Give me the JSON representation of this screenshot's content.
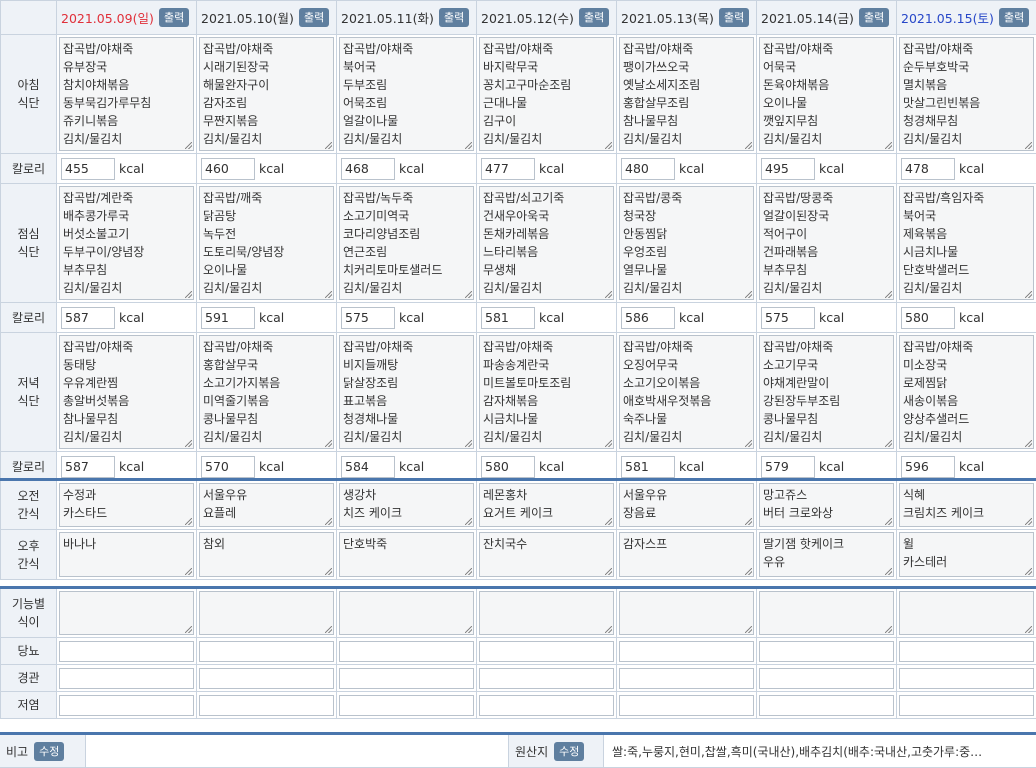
{
  "print_label": "출력",
  "kcal_unit": "kcal",
  "days": [
    {
      "date": "2021.05.09(일)",
      "type": "sun"
    },
    {
      "date": "2021.05.10(월)",
      "type": "wk"
    },
    {
      "date": "2021.05.11(화)",
      "type": "wk"
    },
    {
      "date": "2021.05.12(수)",
      "type": "wk"
    },
    {
      "date": "2021.05.13(목)",
      "type": "wk"
    },
    {
      "date": "2021.05.14(금)",
      "type": "wk"
    },
    {
      "date": "2021.05.15(토)",
      "type": "sat"
    }
  ],
  "labels": {
    "breakfast": "아침\n식단",
    "calorie": "칼로리",
    "lunch": "점심\n식단",
    "dinner": "저녁\n식단",
    "am_snack": "오전\n간식",
    "pm_snack": "오후\n간식",
    "functional": "기능별\n식이",
    "diabetes": "당뇨",
    "tube": "경관",
    "low_salt": "저염"
  },
  "breakfast": [
    [
      "잡곡밥/야채죽",
      "유부장국",
      "참치야채볶음",
      "동부묵김가루무침",
      "쥬키니볶음",
      "김치/물김치"
    ],
    [
      "잡곡밥/야채죽",
      "시래기된장국",
      "해물완자구이",
      "감자조림",
      "무짠지볶음",
      "김치/물김치"
    ],
    [
      "잡곡밥/야채죽",
      "북어국",
      "두부조림",
      "어묵조림",
      "얼갈이나물",
      "김치/물김치"
    ],
    [
      "잡곡밥/야채죽",
      "바지락무국",
      "꽁치고구마순조림",
      "근대나물",
      "김구이",
      "김치/물김치"
    ],
    [
      "잡곡밥/야채죽",
      "팽이가쓰오국",
      "옛날소세지조림",
      "홍합살무조림",
      "참나물무침",
      "김치/물김치"
    ],
    [
      "잡곡밥/야채죽",
      "어묵국",
      "돈육야채볶음",
      "오이나물",
      "깻잎지무침",
      "김치/물김치"
    ],
    [
      "잡곡밥/야채죽",
      "순두부호박국",
      "멸치볶음",
      "맛살그린빈볶음",
      "청경채무침",
      "김치/물김치"
    ]
  ],
  "breakfast_kcal": [
    "455",
    "460",
    "468",
    "477",
    "480",
    "495",
    "478"
  ],
  "lunch": [
    [
      "잡곡밥/계란죽",
      "배추콩가루국",
      "버섯소불고기",
      "두부구이/양념장",
      "부추무침",
      "김치/물김치"
    ],
    [
      "잡곡밥/깨죽",
      "닭곰탕",
      "녹두전",
      "도토리묵/양념장",
      "오이나물",
      "김치/물김치"
    ],
    [
      "잡곡밥/녹두죽",
      "소고기미역국",
      "코다리양념조림",
      "연근조림",
      "치커리토마토샐러드",
      "김치/물김치"
    ],
    [
      "잡곡밥/쇠고기죽",
      "건새우아욱국",
      "돈채카레볶음",
      "느타리볶음",
      "무생채",
      "김치/물김치"
    ],
    [
      "잡곡밥/콩죽",
      "청국장",
      "안동찜닭",
      "우엉조림",
      "열무나물",
      "김치/물김치"
    ],
    [
      "잡곡밥/땅콩죽",
      "얼갈이된장국",
      "적어구이",
      "건파래볶음",
      "부추무침",
      "김치/물김치"
    ],
    [
      "잡곡밥/흑임자죽",
      "북어국",
      "제육볶음",
      "시금치나물",
      "단호박샐러드",
      "김치/물김치"
    ]
  ],
  "lunch_kcal": [
    "587",
    "591",
    "575",
    "581",
    "586",
    "575",
    "580"
  ],
  "dinner": [
    [
      "잡곡밥/야채죽",
      "동태탕",
      "우유계란찜",
      "총알버섯볶음",
      "참나물무침",
      "김치/물김치"
    ],
    [
      "잡곡밥/야채죽",
      "홍합살무국",
      "소고기가지볶음",
      "미역줄기볶음",
      "콩나물무침",
      "김치/물김치"
    ],
    [
      "잡곡밥/야채죽",
      "비지들깨탕",
      "닭살장조림",
      "표고볶음",
      "청경채나물",
      "김치/물김치"
    ],
    [
      "잡곡밥/야채죽",
      "파송송계란국",
      "미트볼토마토조림",
      "감자채볶음",
      "시금치나물",
      "김치/물김치"
    ],
    [
      "잡곡밥/야채죽",
      "오징어무국",
      "소고기오이볶음",
      "애호박새우젓볶음",
      "숙주나물",
      "김치/물김치"
    ],
    [
      "잡곡밥/야채죽",
      "소고기무국",
      "야채계란말이",
      "강된장두부조림",
      "콩나물무침",
      "김치/물김치"
    ],
    [
      "잡곡밥/야채죽",
      "미소장국",
      "로제찜닭",
      "새송이볶음",
      "양상추샐러드",
      "김치/물김치"
    ]
  ],
  "dinner_kcal": [
    "587",
    "570",
    "584",
    "580",
    "581",
    "579",
    "596"
  ],
  "am_snack": [
    [
      "수정과",
      "카스타드"
    ],
    [
      "서울우유",
      "요플레"
    ],
    [
      "생강차",
      "치즈 케이크"
    ],
    [
      "레몬홍차",
      "요거트 케이크"
    ],
    [
      "서울우유",
      "장음료"
    ],
    [
      "망고쥬스",
      "버터 크로와상"
    ],
    [
      "식혜",
      "크림치즈 케이크"
    ]
  ],
  "pm_snack": [
    [
      "바나나"
    ],
    [
      "참외"
    ],
    [
      "단호박죽"
    ],
    [
      "잔치국수"
    ],
    [
      "감자스프"
    ],
    [
      "딸기잼 핫케이크",
      "우유"
    ],
    [
      "윌",
      "카스테러"
    ]
  ],
  "footer": {
    "bigo_label": "비고",
    "edit_label": "수정",
    "origin_label": "원산지",
    "origin_text": "쌀:죽,누룽지,현미,찹쌀,흑미(국내산),배추김치(배추:국내산,고춧가루:중…"
  }
}
